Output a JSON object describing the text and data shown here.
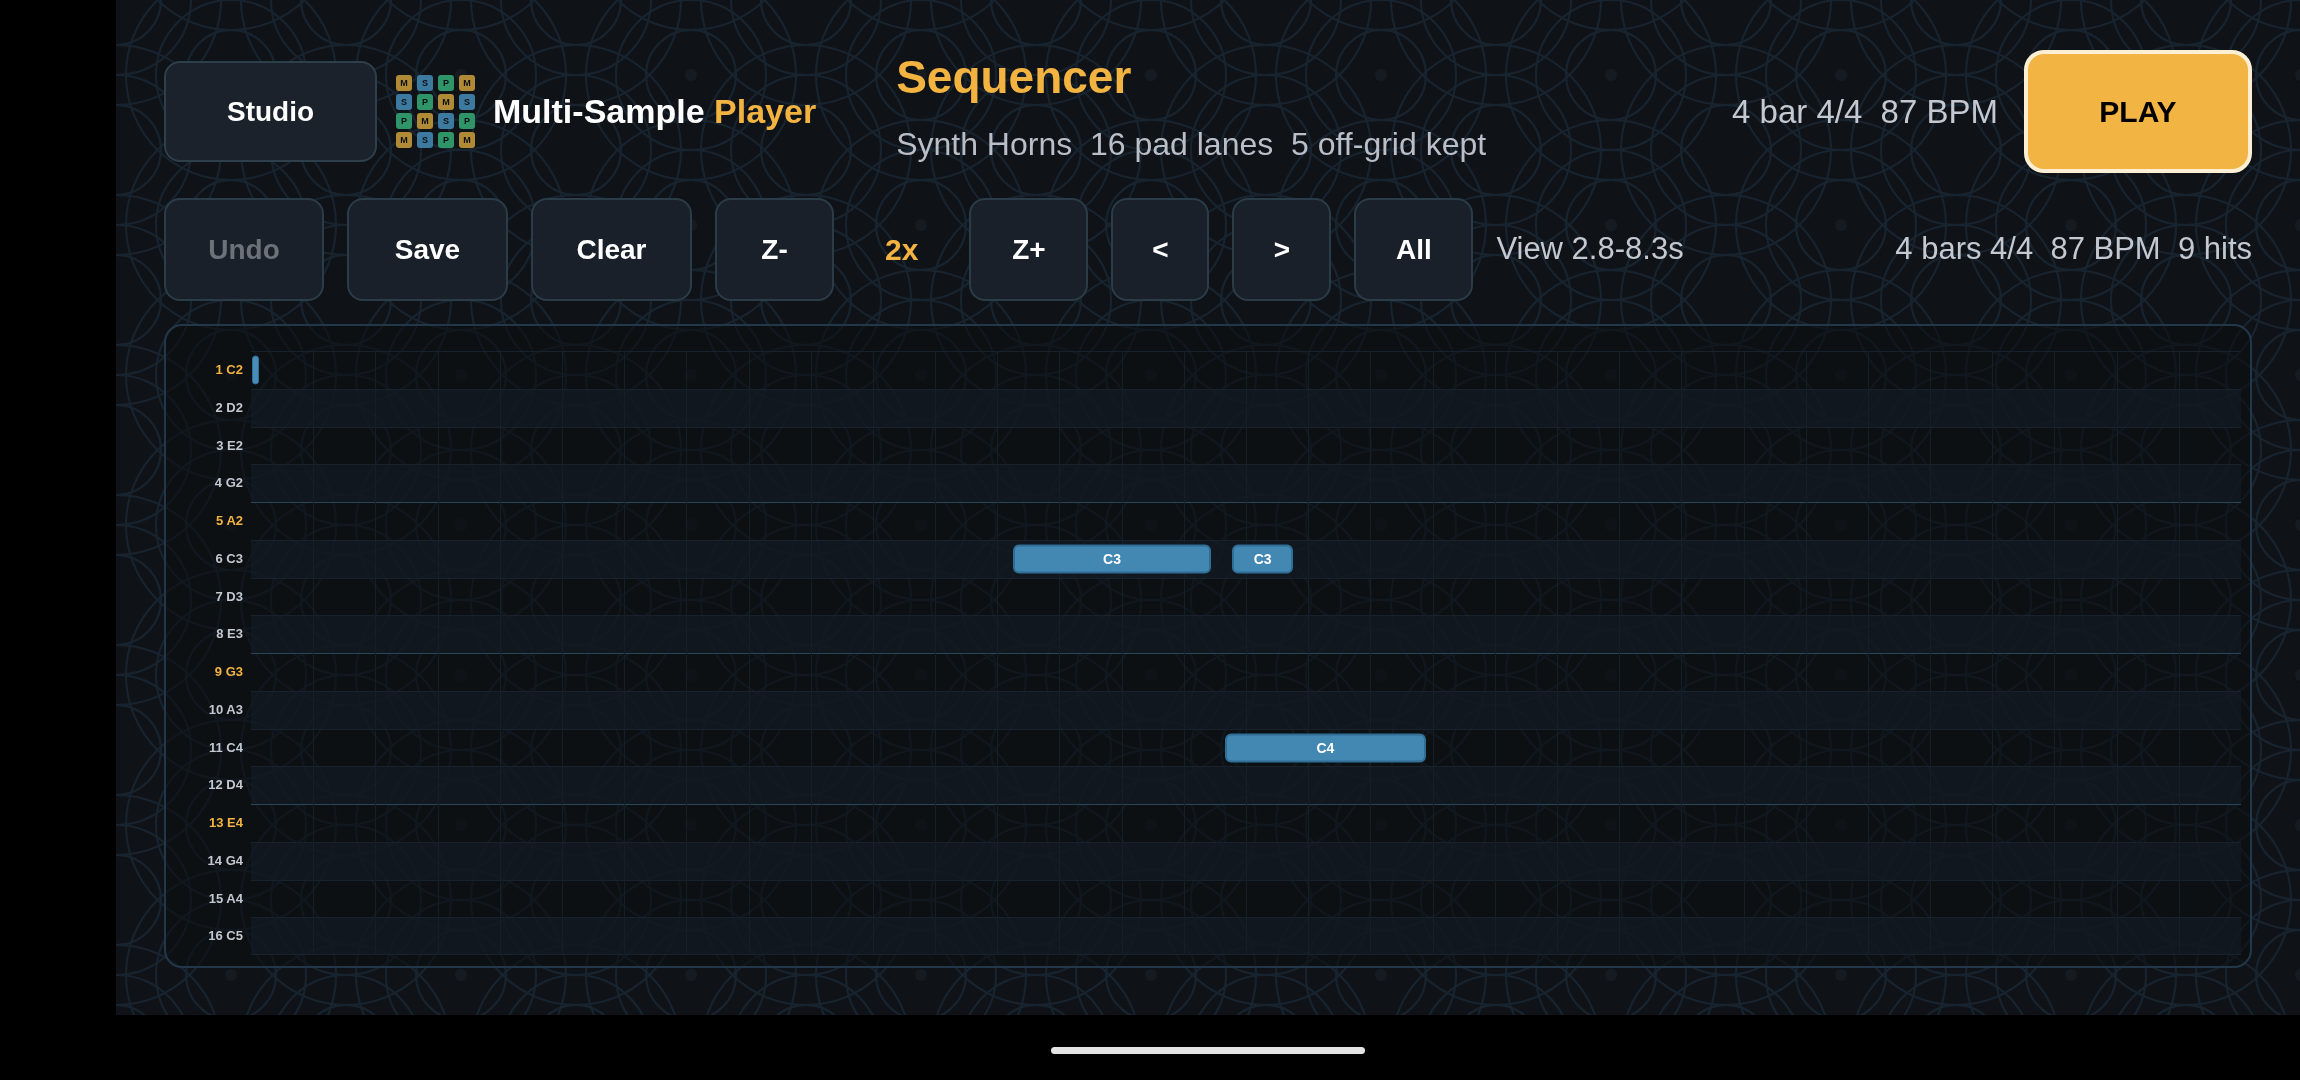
{
  "header": {
    "studio_button": "Studio",
    "logo_tiles": [
      {
        "letter": "M",
        "color": "#b08a35"
      },
      {
        "letter": "S",
        "color": "#3d7aa0"
      },
      {
        "letter": "P",
        "color": "#2f9468"
      },
      {
        "letter": "M",
        "color": "#b08a35"
      },
      {
        "letter": "S",
        "color": "#3d7aa0"
      },
      {
        "letter": "P",
        "color": "#2f9468"
      },
      {
        "letter": "M",
        "color": "#b08a35"
      },
      {
        "letter": "S",
        "color": "#3d7aa0"
      },
      {
        "letter": "P",
        "color": "#2f9468"
      },
      {
        "letter": "M",
        "color": "#b08a35"
      },
      {
        "letter": "S",
        "color": "#3d7aa0"
      },
      {
        "letter": "P",
        "color": "#2f9468"
      },
      {
        "letter": "M",
        "color": "#b08a35"
      },
      {
        "letter": "S",
        "color": "#3d7aa0"
      },
      {
        "letter": "P",
        "color": "#2f9468"
      },
      {
        "letter": "M",
        "color": "#b08a35"
      }
    ],
    "app_name": [
      {
        "text": "Multi-Sample",
        "accent": false
      },
      {
        "text": "Player",
        "accent": true
      }
    ],
    "title": "Sequencer",
    "subtitle": "Synth Horns  16 pad lanes  5 off-grid kept",
    "meter": "4 bar 4/4  87 BPM",
    "play_button": "PLAY"
  },
  "toolbar": {
    "items": [
      {
        "kind": "button",
        "label": "Undo",
        "disabled": true
      },
      {
        "kind": "button",
        "label": "Save",
        "disabled": false
      },
      {
        "kind": "button",
        "label": "Clear",
        "disabled": false
      },
      {
        "kind": "button",
        "label": "Z-",
        "disabled": false
      },
      {
        "kind": "readout",
        "label": "2x"
      },
      {
        "kind": "button",
        "label": "Z+",
        "disabled": false
      },
      {
        "kind": "button",
        "label": "<",
        "disabled": false
      },
      {
        "kind": "button",
        "label": ">",
        "disabled": false
      },
      {
        "kind": "button",
        "label": "All",
        "disabled": false
      }
    ],
    "view_range": "View 2.8-8.3s",
    "stats": "4 bars 4/4  87 BPM  9 hits"
  },
  "lanes": [
    {
      "label": "1 C2",
      "accent": true,
      "notes": [
        {
          "kind": "stub"
        }
      ]
    },
    {
      "label": "2 D2",
      "accent": false
    },
    {
      "label": "3 E2",
      "accent": false
    },
    {
      "label": "4 G2",
      "accent": false
    },
    {
      "label": "5 A2",
      "accent": true
    },
    {
      "label": "6 C3",
      "accent": false,
      "notes": [
        {
          "kind": "note",
          "label": "C3"
        },
        {
          "kind": "note",
          "label": "C3"
        }
      ]
    },
    {
      "label": "7 D3",
      "accent": false
    },
    {
      "label": "8 E3",
      "accent": false
    },
    {
      "label": "9 G3",
      "accent": true
    },
    {
      "label": "10 A3",
      "accent": false
    },
    {
      "label": "11 C4",
      "accent": false,
      "notes": [
        {
          "kind": "note",
          "label": "C4"
        }
      ]
    },
    {
      "label": "12 D4",
      "accent": false
    },
    {
      "label": "13 E4",
      "accent": true
    },
    {
      "label": "14 G4",
      "accent": false
    },
    {
      "label": "15 A4",
      "accent": false
    },
    {
      "label": "16 C5",
      "accent": false
    }
  ]
}
